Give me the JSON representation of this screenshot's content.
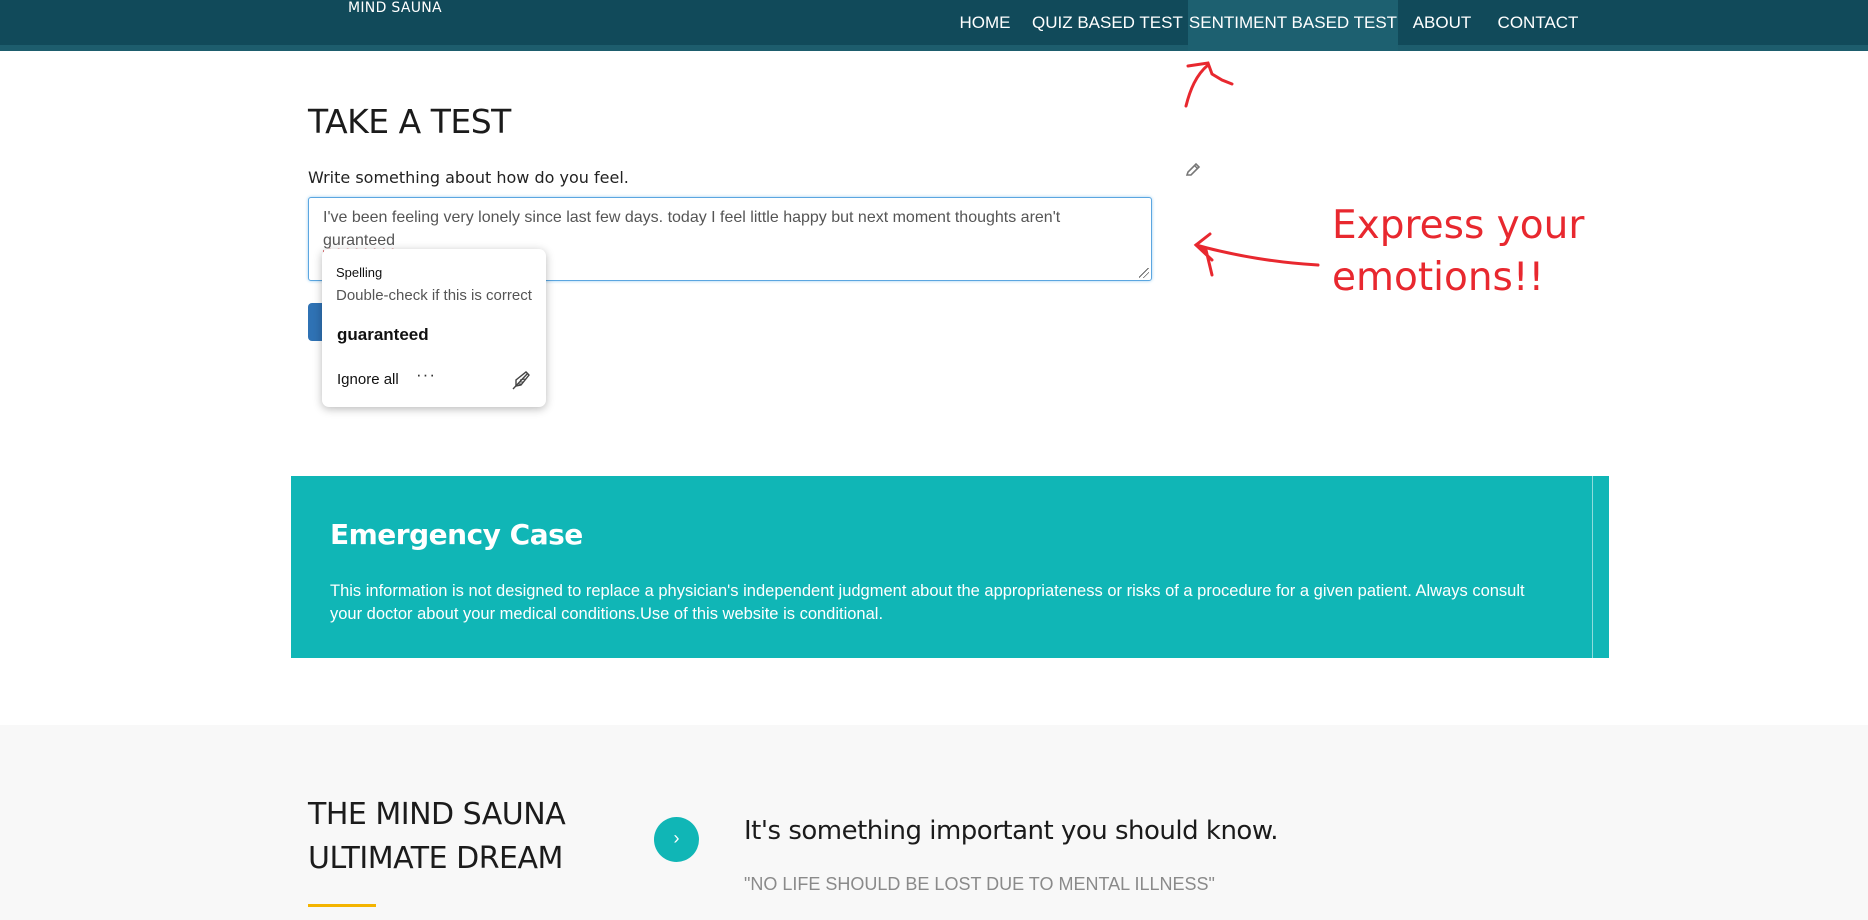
{
  "header": {
    "logo_text": "MIND SAUNA",
    "nav": [
      {
        "label": "HOME"
      },
      {
        "label": "QUIZ BASED TEST"
      },
      {
        "label": "SENTIMENT BASED TEST"
      },
      {
        "label": "ABOUT"
      },
      {
        "label": "CONTACT"
      }
    ],
    "active_nav": "SENTIMENT BASED TEST"
  },
  "test": {
    "title": "TAKE A TEST",
    "prompt": "Write something about how do you feel.",
    "input_value_before": "I've been feeling very lonely since last few days. today I feel little happy but next moment thoughts aren't ",
    "input_value_misspelled": "guranteed"
  },
  "spell_popup": {
    "heading": "Spelling",
    "hint": "Double-check if this is correct",
    "suggestion": "guaranteed",
    "ignore_label": "Ignore all",
    "more_label": "···"
  },
  "annotation": {
    "line1": "Express your",
    "line2": "emotions!!",
    "color": "#e8282f"
  },
  "emergency": {
    "title": "Emergency Case",
    "text": "This information is not designed to replace a physician's independent judgment about the appropriateness or risks of a procedure for a given patient. Always consult your doctor about your medical conditions.Use of this website is conditional."
  },
  "footer": {
    "dream_line1": "THE MIND SAUNA",
    "dream_line2": "ULTIMATE DREAM",
    "know_title": "It's something important you should know.",
    "quote": "\"NO LIFE SHOULD BE LOST DUE TO MENTAL ILLNESS\"",
    "circle_icon": "chevron-right-icon"
  },
  "colors": {
    "header_bg": "#114a5a",
    "active_nav_bg": "#1d6070",
    "teal": "#10b6b6",
    "accent_underline": "#f4b400"
  }
}
